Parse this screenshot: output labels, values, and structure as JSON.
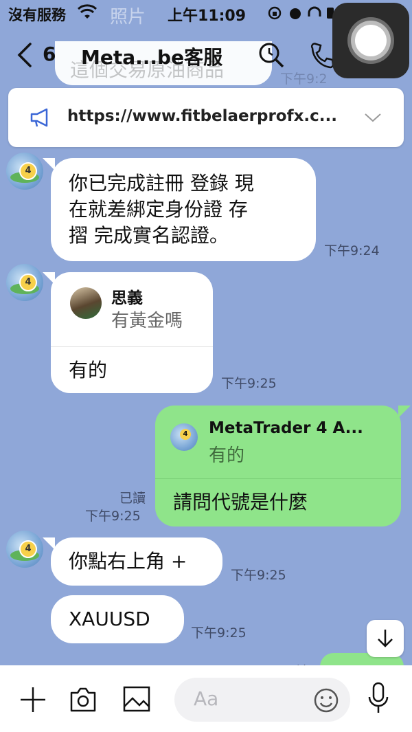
{
  "status_bar": {
    "carrier": "沒有服務",
    "time": "上午11:09"
  },
  "header": {
    "back_count": "6",
    "title": "Meta...be客服"
  },
  "background_hint": {
    "photo_label": "照片",
    "faded_text": "這個交易原油商品",
    "faded_ts": "下午9:2"
  },
  "announcement": {
    "text": "https://www.fitbelaerprofx.c..."
  },
  "messages": [
    {
      "lines": [
        "你已完成註冊 登錄 現",
        "在就差綁定身份證 存",
        "摺 完成實名認證。"
      ],
      "time": "下午9:24"
    },
    {
      "reply_name": "思義",
      "reply_text": "有黃金嗎",
      "text": "有的",
      "time": "下午9:25"
    },
    {
      "reply_name": "MetaTrader 4 A...",
      "reply_text": "有的",
      "text": "請問代號是什麼",
      "read": "已讀",
      "time": "下午9:25"
    },
    {
      "text": "你點右上角 +",
      "time": "下午9:25"
    },
    {
      "text": "XAUUSD",
      "time": "下午9:25"
    }
  ],
  "peek_read": "已讀",
  "input": {
    "placeholder": "Aa"
  },
  "colors": {
    "chat_bg": "#8fa7d8",
    "own_bubble": "#8fe48a",
    "other_bubble": "#ffffff"
  }
}
